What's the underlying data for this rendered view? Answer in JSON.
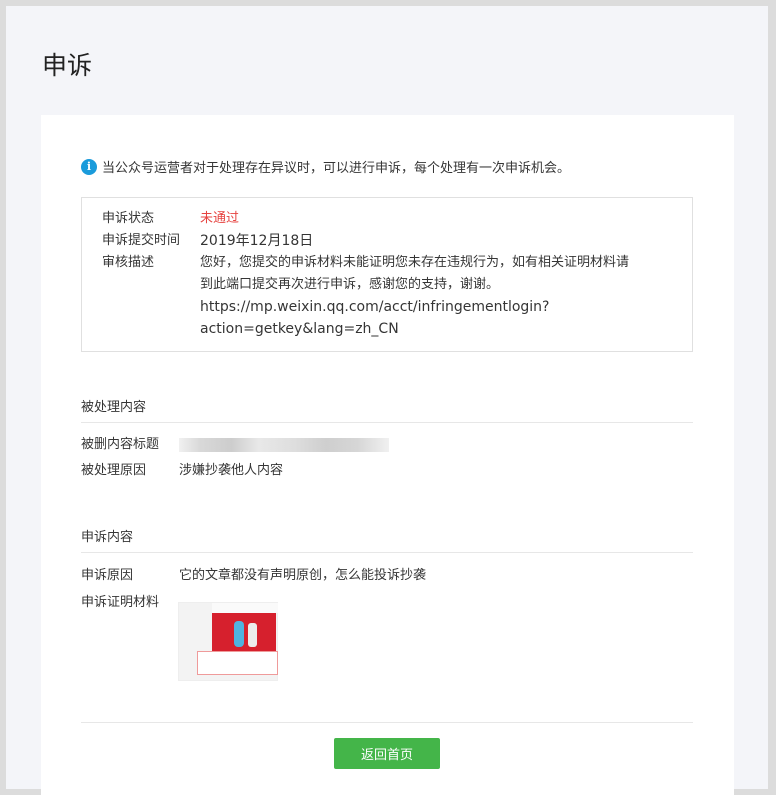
{
  "page": {
    "title": "申诉"
  },
  "notice": {
    "text": "当公众号运营者对于处理存在异议时，可以进行申诉，每个处理有一次申诉机会。"
  },
  "status": {
    "state_label": "申诉状态",
    "state_value": "未通过",
    "time_label": "申诉提交时间",
    "time_value": "2019年12月18日",
    "desc_label": "审核描述",
    "desc_line1": "您好，您提交的申诉材料未能证明您未存在违规行为，如有相关证明材料请",
    "desc_line2": "到此端口提交再次进行申诉，感谢您的支持，谢谢。",
    "desc_line3": "https://mp.weixin.qq.com/acct/infringementlogin?",
    "desc_line4": "action=getkey&lang=zh_CN"
  },
  "processed": {
    "section_title": "被处理内容",
    "deleted_title_label": "被删内容标题",
    "reason_label": "被处理原因",
    "reason_value": "涉嫌抄袭他人内容"
  },
  "appeal": {
    "section_title": "申诉内容",
    "reason_label": "申诉原因",
    "reason_value": "它的文章都没有声明原创，怎么能投诉抄袭",
    "evidence_label": "申诉证明材料"
  },
  "actions": {
    "home_label": "返回首页"
  },
  "colors": {
    "accent": "#44b549",
    "failed": "#e64340",
    "info": "#1a9bdb"
  }
}
